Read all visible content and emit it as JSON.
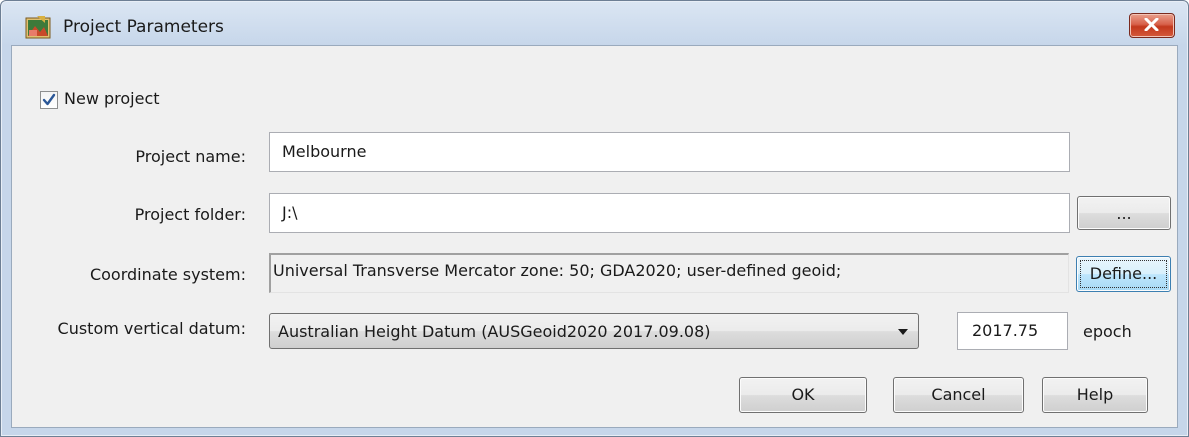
{
  "window": {
    "title": "Project Parameters",
    "icon": "project-parameters-app-icon"
  },
  "new_project": {
    "label": "New project",
    "checked": true
  },
  "project_name": {
    "label": "Project name:",
    "value": "Melbourne"
  },
  "project_folder": {
    "label": "Project folder:",
    "value": "J:\\",
    "browse_label": "..."
  },
  "coordinate_system": {
    "label": "Coordinate system:",
    "value": "Universal Transverse Mercator zone: 50; GDA2020; user-defined geoid;",
    "define_label": "Define..."
  },
  "vertical_datum": {
    "label": "Custom vertical datum:",
    "selected": "Australian Height Datum (AUSGeoid2020 2017.09.08)",
    "epoch_value": "2017.75",
    "epoch_label": "epoch"
  },
  "buttons": {
    "ok": "OK",
    "cancel": "Cancel",
    "help": "Help"
  },
  "colors": {
    "close_button": "#c3381d",
    "focus_border": "#3c7fb1",
    "checkmark": "#2b5797"
  }
}
